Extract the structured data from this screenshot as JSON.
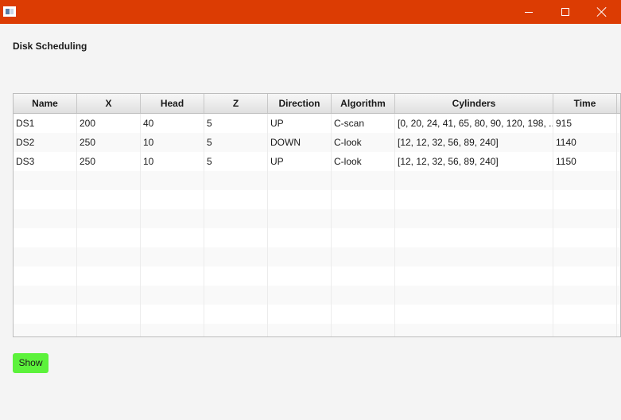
{
  "window": {
    "icon": "app-window-icon",
    "controls": [
      "minimize-icon",
      "maximize-icon",
      "close-icon"
    ]
  },
  "page": {
    "title": "Disk Scheduling"
  },
  "table": {
    "columns": [
      "Name",
      "X",
      "Head",
      "Z",
      "Direction",
      "Algorithm",
      "Cylinders",
      "Time"
    ],
    "rows": [
      [
        "DS1",
        "200",
        "40",
        "5",
        "UP",
        "C-scan",
        "[0, 20, 24, 41, 65, 80, 90, 120, 198, ...",
        "915"
      ],
      [
        "DS2",
        "250",
        "10",
        "5",
        "DOWN",
        "C-look",
        "[12, 12, 32, 56, 89, 240]",
        "1140"
      ],
      [
        "DS3",
        "250",
        "10",
        "5",
        "UP",
        "C-look",
        "[12, 12, 32, 56, 89, 240]",
        "1150"
      ],
      [
        "",
        "",
        "",
        "",
        "",
        "",
        "",
        ""
      ],
      [
        "",
        "",
        "",
        "",
        "",
        "",
        "",
        ""
      ],
      [
        "",
        "",
        "",
        "",
        "",
        "",
        "",
        ""
      ],
      [
        "",
        "",
        "",
        "",
        "",
        "",
        "",
        ""
      ],
      [
        "",
        "",
        "",
        "",
        "",
        "",
        "",
        ""
      ],
      [
        "",
        "",
        "",
        "",
        "",
        "",
        "",
        ""
      ],
      [
        "",
        "",
        "",
        "",
        "",
        "",
        "",
        ""
      ],
      [
        "",
        "",
        "",
        "",
        "",
        "",
        "",
        ""
      ],
      [
        "",
        "",
        "",
        "",
        "",
        "",
        "",
        ""
      ]
    ]
  },
  "actions": {
    "show_label": "Show"
  },
  "colors": {
    "titlebar": "#dc3c03",
    "show_button": "#5cf23b"
  }
}
